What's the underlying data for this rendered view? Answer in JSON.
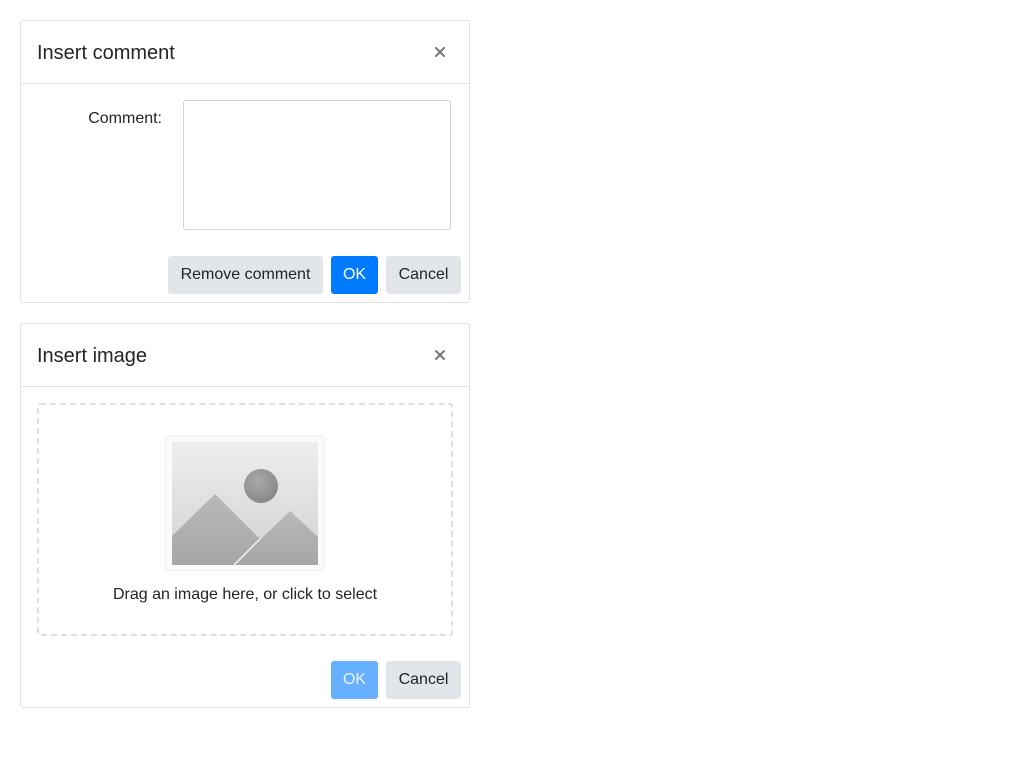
{
  "comment_dialog": {
    "title": "Insert comment",
    "comment_label": "Comment:",
    "comment_value": "",
    "remove_label": "Remove comment",
    "ok_label": "OK",
    "cancel_label": "Cancel",
    "close_icon": "close-icon"
  },
  "image_dialog": {
    "title": "Insert image",
    "placeholder_icon": "image-placeholder-icon",
    "dropzone_text": "Drag an image here, or click to select",
    "ok_label": "OK",
    "ok_disabled": true,
    "cancel_label": "Cancel",
    "close_icon": "close-icon"
  },
  "colors": {
    "primary": "#007bff",
    "primary_disabled": "#66b0ff",
    "secondary": "#e2e6ea",
    "border": "#dee2e6"
  }
}
